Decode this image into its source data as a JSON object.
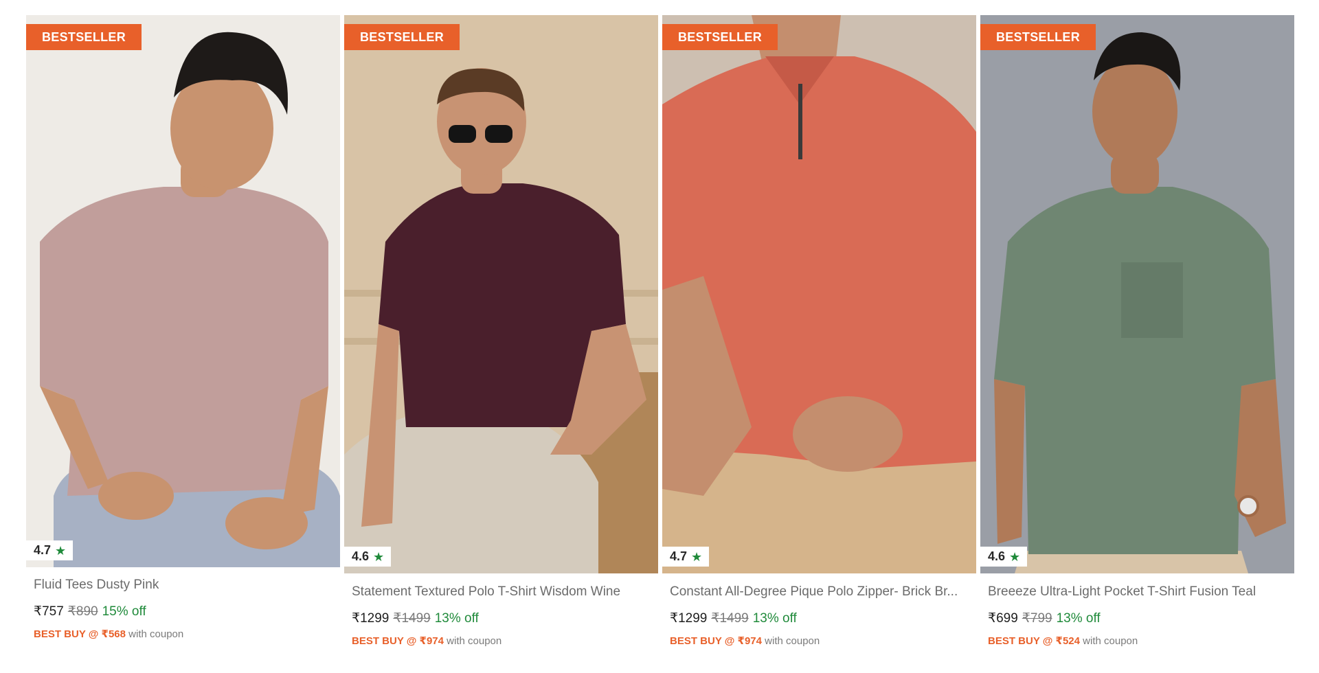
{
  "products": [
    {
      "badge": "BESTSELLER",
      "rating": "4.7",
      "title": "Fluid Tees Dusty Pink",
      "price": "₹757",
      "mrp": "₹890",
      "discount": "15% off",
      "best_buy": "BEST BUY @ ₹568",
      "coupon_text": "with coupon",
      "shirt_color": "#c19e9b",
      "bg_color": "#f1efeb"
    },
    {
      "badge": "BESTSELLER",
      "rating": "4.6",
      "title": "Statement Textured Polo T-Shirt Wisdom Wine",
      "price": "₹1299",
      "mrp": "₹1499",
      "discount": "13% off",
      "best_buy": "BEST BUY @ ₹974",
      "coupon_text": "with coupon",
      "shirt_color": "#4a1f2c",
      "bg_color": "#d8c3a6"
    },
    {
      "badge": "BESTSELLER",
      "rating": "4.7",
      "title": "Constant All-Degree Pique Polo Zipper- Brick Br...",
      "price": "₹1299",
      "mrp": "₹1499",
      "discount": "13% off",
      "best_buy": "BEST BUY @ ₹974",
      "coupon_text": "with coupon",
      "shirt_color": "#d96b55",
      "bg_color": "#cdbfb1"
    },
    {
      "badge": "BESTSELLER",
      "rating": "4.6",
      "title": "Breeeze Ultra-Light Pocket T-Shirt Fusion Teal",
      "price": "₹699",
      "mrp": "₹799",
      "discount": "13% off",
      "best_buy": "BEST BUY @ ₹524",
      "coupon_text": "with coupon",
      "shirt_color": "#6f8672",
      "bg_color": "#9a9ea6"
    }
  ],
  "colors": {
    "accent": "#e8602a",
    "discount_green": "#1f8a3a",
    "star_green": "#1f8a3a"
  },
  "icons": {
    "rating_star": "star-icon"
  }
}
